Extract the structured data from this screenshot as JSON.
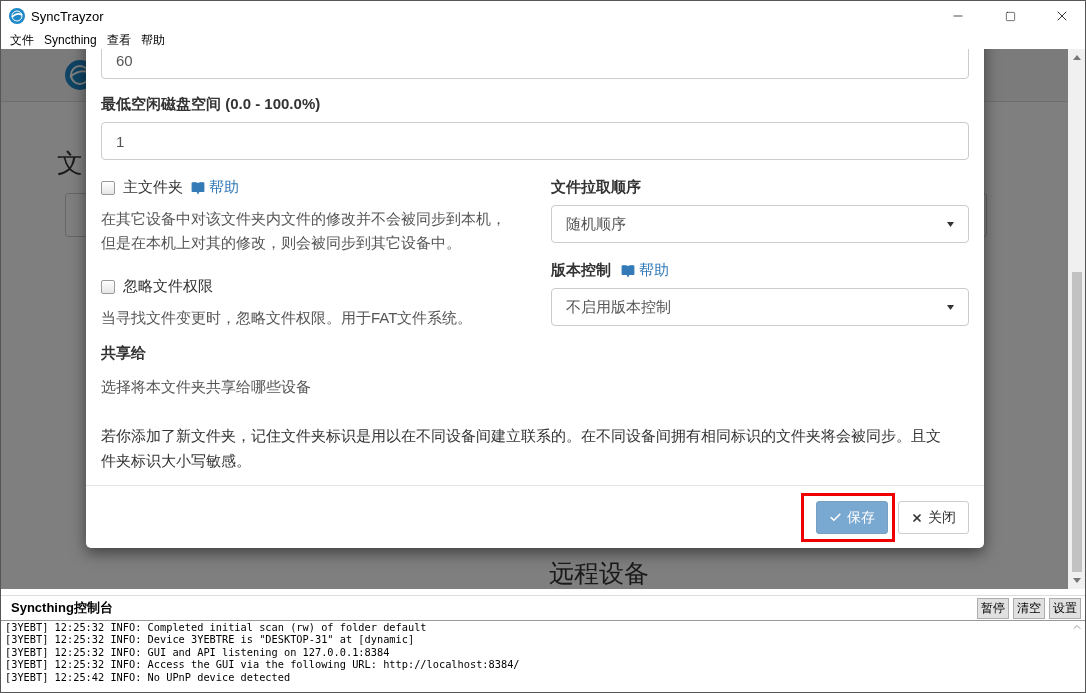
{
  "window": {
    "title": "SyncTrayzor"
  },
  "menu": [
    "文件",
    "Syncthing",
    "查看",
    "帮助"
  ],
  "background_page": {
    "heading": "文",
    "section_heading": "远程设备"
  },
  "dialog": {
    "top_field": {
      "value": "60"
    },
    "min_disk": {
      "label": "最低空闲磁盘空间 (0.0 - 100.0%)",
      "value": "1"
    },
    "options": [
      {
        "label": "主文件夹",
        "checked": false,
        "help": "帮助",
        "description": "在其它设备中对该文件夹内文件的修改并不会被同步到本机，但是在本机上对其的修改，则会被同步到其它设备中。"
      },
      {
        "label": "忽略文件权限",
        "checked": false,
        "description": "当寻找文件变更时，忽略文件权限。用于FAT文件系统。"
      }
    ],
    "share": {
      "title": "共享给",
      "description": "选择将本文件夹共享给哪些设备"
    },
    "pull_order": {
      "label": "文件拉取顺序",
      "value": "随机顺序"
    },
    "versioning": {
      "label": "版本控制",
      "help": "帮助",
      "value": "不启用版本控制"
    },
    "note": "若你添加了新文件夹，记住文件夹标识是用以在不同设备间建立联系的。在不同设备间拥有相同标识的文件夹将会被同步。且文件夹标识大小写敏感。",
    "buttons": [
      {
        "kind": "primary",
        "label": "保存",
        "disabled": true
      },
      {
        "kind": "default",
        "label": "关闭"
      }
    ]
  },
  "console": {
    "title": "Syncthing控制台",
    "buttons": [
      "暂停",
      "清空",
      "设置"
    ],
    "lines": [
      "[3YEBT] 12:25:32 INFO: Completed initial scan (rw) of folder default",
      "[3YEBT] 12:25:32 INFO: Device 3YEBTRE is \"DESKTOP-31\" at [dynamic]",
      "[3YEBT] 12:25:32 INFO: GUI and API listening on 127.0.0.1:8384",
      "[3YEBT] 12:25:32 INFO: Access the GUI via the following URL: http://localhost:8384/",
      "[3YEBT] 12:25:42 INFO: No UPnP device detected"
    ]
  }
}
